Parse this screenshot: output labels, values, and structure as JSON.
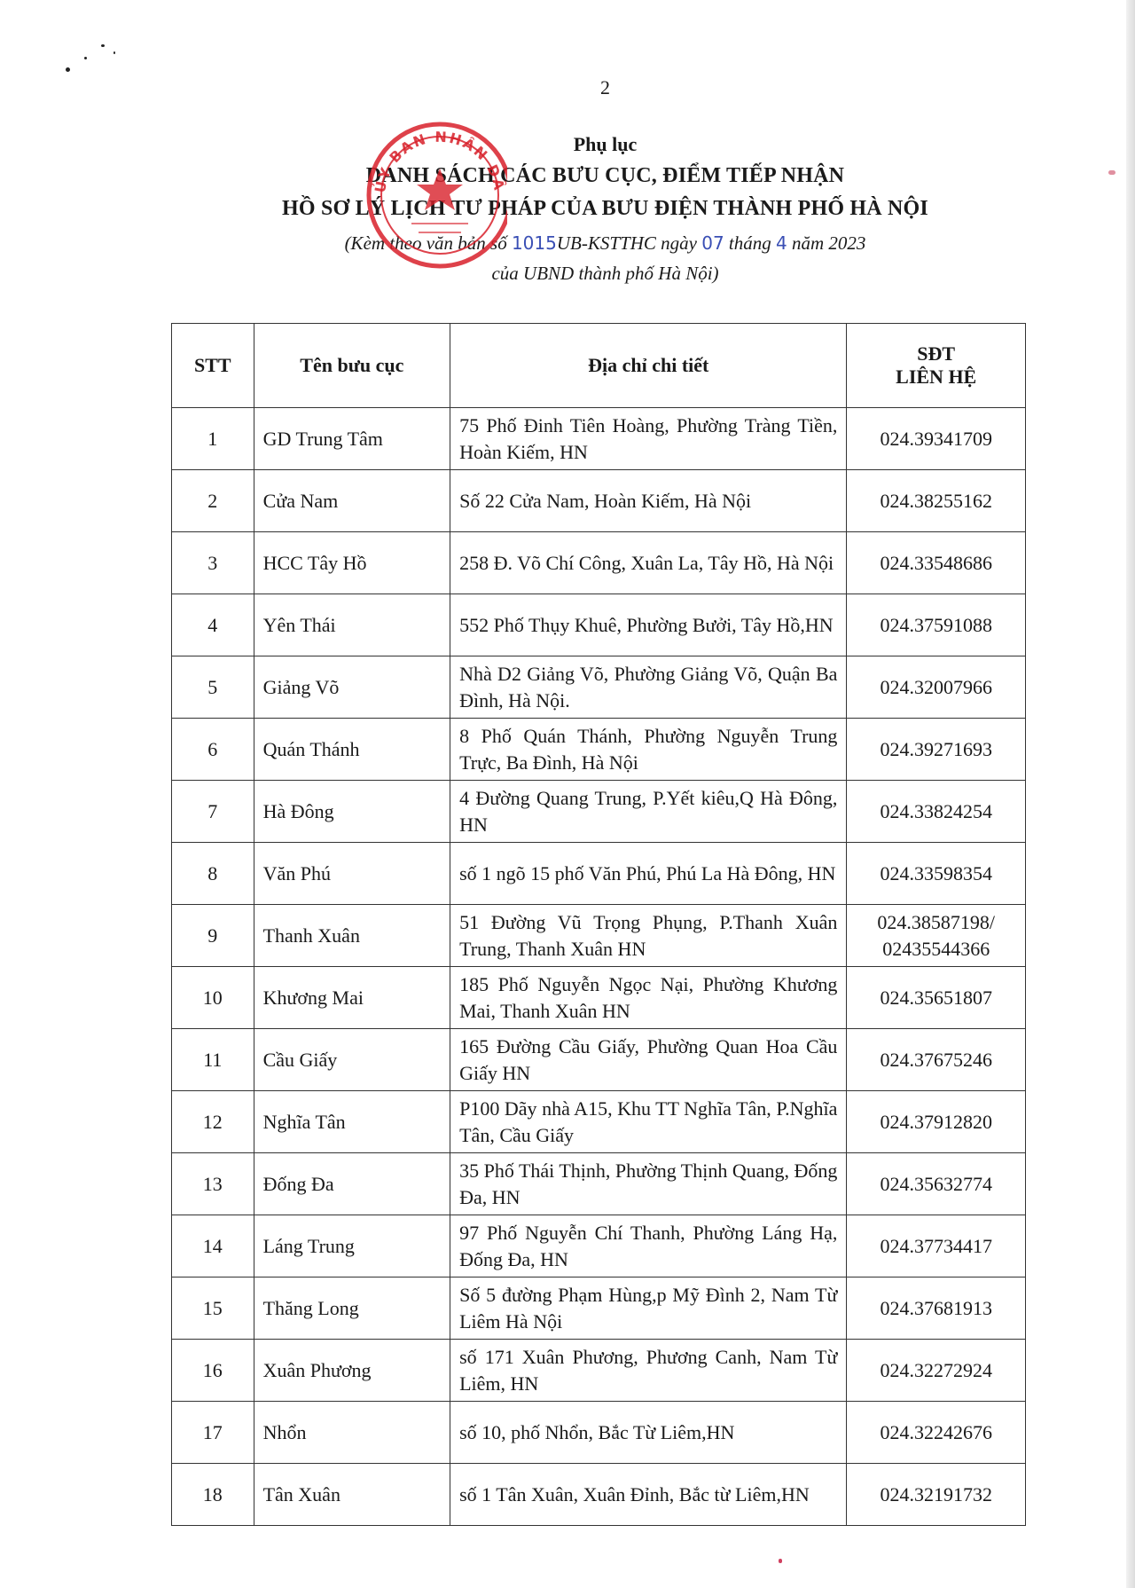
{
  "page_number": "2",
  "header": {
    "appendix": "Phụ lục",
    "title_line_1": "DANH SÁCH CÁC BƯU CỤC, ĐIỂM TIẾP NHẬN",
    "title_line_2": "HỒ SƠ LÝ LỊCH TƯ PHÁP CỦA BƯU ĐIỆN THÀNH PHỐ HÀ NỘI",
    "subtitle_prefix": "(Kèm theo văn bản số",
    "doc_number_handwritten": "1015",
    "subtitle_code": "UB-KSTTHC ngày",
    "day_handwritten": "07",
    "month_label": "tháng",
    "month_handwritten": "4",
    "year_label": "năm 2023",
    "subtitle_line_2": "của UBND thành phố Hà Nội)"
  },
  "stamp": {
    "text": "ỦY BAN NHÂN DÂN THÀNH PHỐ HÀ NỘI",
    "color": "#d8202a"
  },
  "table": {
    "headers": {
      "stt": "STT",
      "name": "Tên bưu cục",
      "address": "Địa chỉ chi tiết",
      "phone_line_1": "SĐT",
      "phone_line_2": "LIÊN HỆ"
    },
    "rows": [
      {
        "stt": "1",
        "name": "GD Trung Tâm",
        "address": "75 Phố Đinh Tiên Hoàng, Phường Tràng Tiền, Hoàn Kiếm, HN",
        "phone": "024.39341709"
      },
      {
        "stt": "2",
        "name": "Cửa Nam",
        "address": "Số 22 Cửa Nam, Hoàn Kiếm, Hà Nội",
        "phone": "024.38255162"
      },
      {
        "stt": "3",
        "name": "HCC Tây Hồ",
        "address": "258 Đ. Võ Chí Công, Xuân La, Tây Hồ, Hà Nội",
        "phone": "024.33548686"
      },
      {
        "stt": "4",
        "name": "Yên Thái",
        "address": "552 Phố Thụy Khuê, Phường Bưởi, Tây Hồ,HN",
        "phone": "024.37591088"
      },
      {
        "stt": "5",
        "name": "Giảng Võ",
        "address": "Nhà D2 Giảng Võ, Phường Giảng Võ, Quận Ba Đình, Hà Nội.",
        "phone": "024.32007966"
      },
      {
        "stt": "6",
        "name": "Quán Thánh",
        "address": "8 Phố Quán Thánh, Phường Nguyễn Trung Trực, Ba Đình, Hà Nội",
        "phone": "024.39271693"
      },
      {
        "stt": "7",
        "name": "Hà Đông",
        "address": "4 Đường Quang Trung, P.Yết kiêu,Q Hà Đông, HN",
        "phone": "024.33824254"
      },
      {
        "stt": "8",
        "name": "Văn Phú",
        "address": "số 1 ngõ 15 phố Văn Phú, Phú La Hà Đông, HN",
        "phone": "024.33598354"
      },
      {
        "stt": "9",
        "name": "Thanh Xuân",
        "address": "51 Đường Vũ Trọng Phụng, P.Thanh Xuân Trung, Thanh Xuân HN",
        "phone": "024.38587198/",
        "phone_2": "02435544366"
      },
      {
        "stt": "10",
        "name": "Khương Mai",
        "address": "185 Phố Nguyễn Ngọc Nại, Phường Khương Mai, Thanh Xuân HN",
        "phone": "024.35651807"
      },
      {
        "stt": "11",
        "name": "Cầu Giấy",
        "address": "165 Đường Cầu Giấy, Phường Quan Hoa Cầu Giấy HN",
        "phone": "024.37675246"
      },
      {
        "stt": "12",
        "name": "Nghĩa Tân",
        "address": "P100 Dãy nhà A15, Khu TT Nghĩa Tân, P.Nghĩa Tân, Cầu Giấy",
        "phone": "024.37912820"
      },
      {
        "stt": "13",
        "name": "Đống Đa",
        "address": "35 Phố Thái Thịnh, Phường Thịnh Quang, Đống Đa, HN",
        "phone": "024.35632774"
      },
      {
        "stt": "14",
        "name": "Láng Trung",
        "address": "97 Phố Nguyễn Chí Thanh, Phường Láng Hạ, Đống Đa, HN",
        "phone": "024.37734417"
      },
      {
        "stt": "15",
        "name": "Thăng Long",
        "address": "Số 5 đường Phạm Hùng,p Mỹ Đình 2, Nam Từ Liêm Hà Nội",
        "phone": "024.37681913"
      },
      {
        "stt": "16",
        "name": "Xuân Phương",
        "address": "số 171 Xuân Phương, Phương Canh, Nam Từ Liêm, HN",
        "phone": "024.32272924"
      },
      {
        "stt": "17",
        "name": "Nhổn",
        "address": "số 10, phố Nhổn, Bắc Từ Liêm,HN",
        "phone": "024.32242676"
      },
      {
        "stt": "18",
        "name": "Tân Xuân",
        "address": "số 1 Tân Xuân, Xuân Đỉnh, Bắc từ Liêm,HN",
        "phone": "024.32191732"
      }
    ]
  }
}
